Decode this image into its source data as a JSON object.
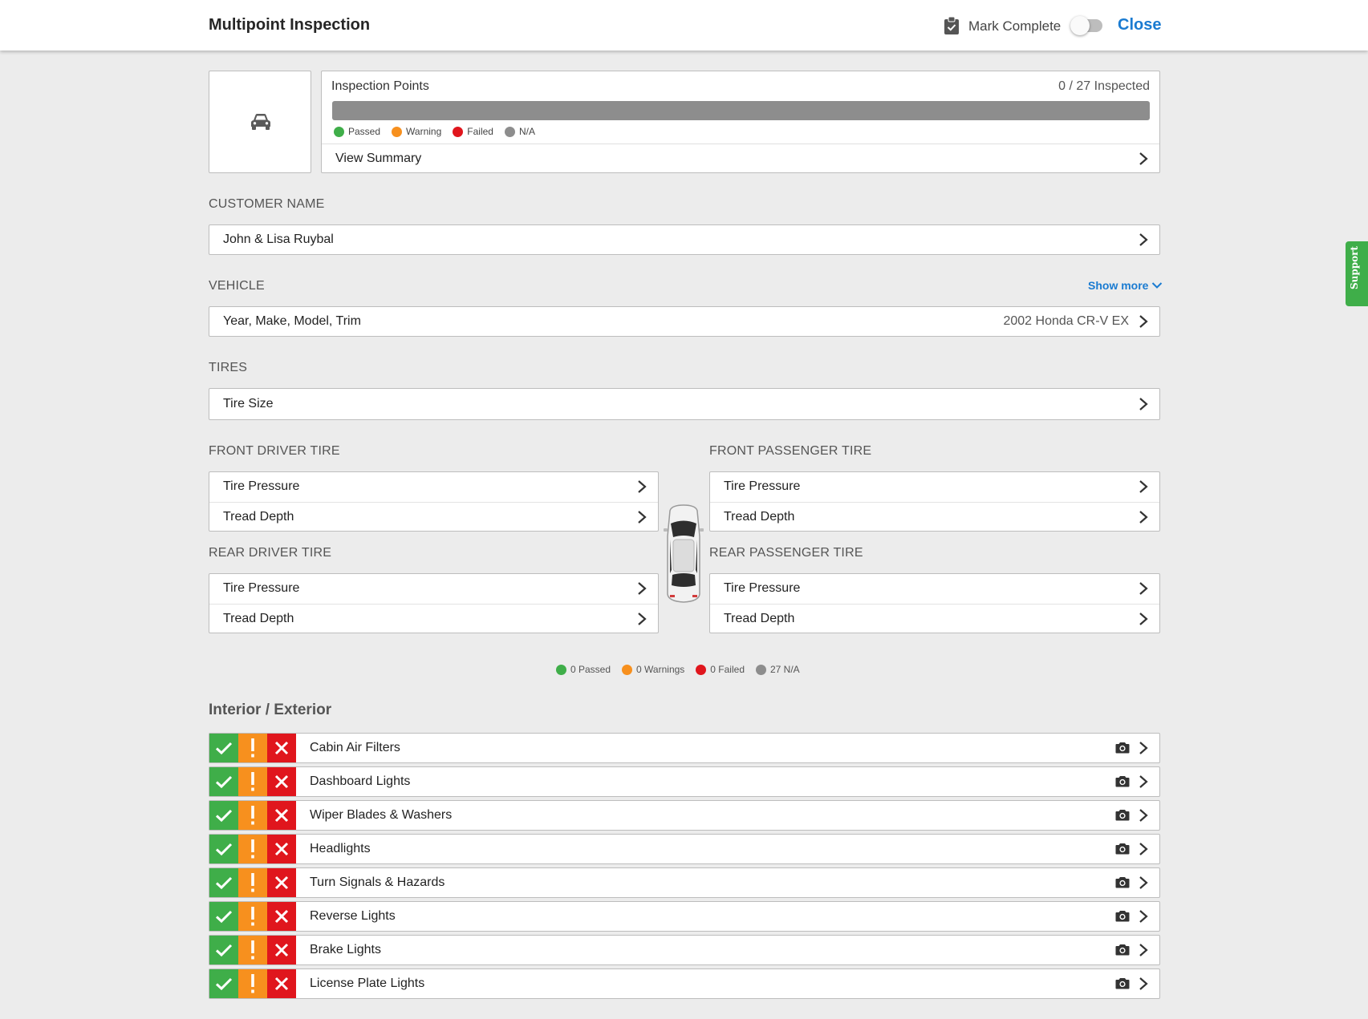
{
  "header": {
    "title": "Multipoint Inspection",
    "mark_complete_label": "Mark Complete",
    "mark_complete_on": false,
    "close_label": "Close"
  },
  "inspection_points": {
    "title": "Inspection Points",
    "count": "0 / 27 Inspected",
    "legend": [
      "Passed",
      "Warning",
      "Failed",
      "N/A"
    ],
    "view_summary": "View Summary"
  },
  "customer": {
    "label": "CUSTOMER NAME",
    "name": "John & Lisa Ruybal"
  },
  "vehicle": {
    "label": "VEHICLE",
    "show_more": "Show more",
    "field": "Year, Make, Model, Trim",
    "value": "2002 Honda CR-V EX"
  },
  "tires": {
    "label": "TIRES",
    "size_label": "Tire Size",
    "front_driver": {
      "label": "FRONT DRIVER TIRE",
      "pressure": "Tire Pressure",
      "tread": "Tread Depth"
    },
    "front_passenger": {
      "label": "FRONT PASSENGER TIRE",
      "pressure": "Tire Pressure",
      "tread": "Tread Depth"
    },
    "rear_driver": {
      "label": "REAR DRIVER TIRE",
      "pressure": "Tire Pressure",
      "tread": "Tread Depth"
    },
    "rear_passenger": {
      "label": "REAR PASSENGER TIRE",
      "pressure": "Tire Pressure",
      "tread": "Tread Depth"
    }
  },
  "summary": {
    "passed": "0 Passed",
    "warnings": "0 Warnings",
    "failed": "0 Failed",
    "na": "27 N/A"
  },
  "interior_exterior": {
    "title": "Interior / Exterior",
    "items": [
      "Cabin Air Filters",
      "Dashboard Lights",
      "Wiper Blades & Washers",
      "Headlights",
      "Turn Signals & Hazards",
      "Reverse Lights",
      "Brake Lights",
      "License Plate Lights"
    ]
  },
  "support": {
    "label": "Support"
  },
  "colors": {
    "passed": "#3fae49",
    "warning": "#f7901e",
    "failed": "#e0161d",
    "na": "#8d8d8d",
    "accent": "#1a7bd1"
  },
  "icons": [
    "clipboard-check-icon",
    "car-icon",
    "chevron-right-icon",
    "chevron-down-icon",
    "check-icon",
    "exclamation-icon",
    "x-icon",
    "camera-icon"
  ]
}
